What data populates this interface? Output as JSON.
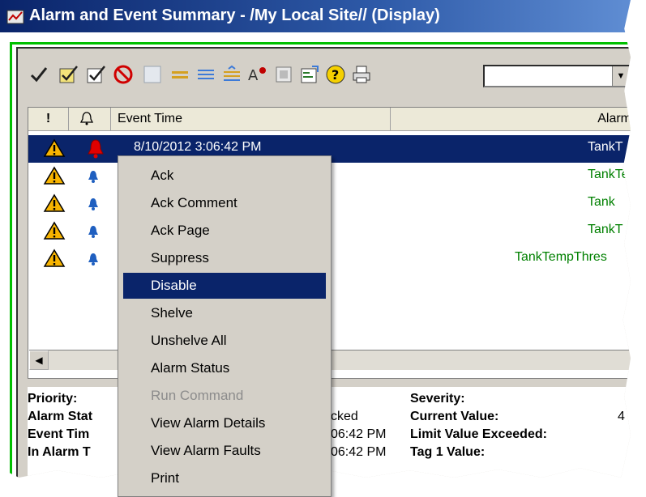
{
  "window": {
    "title": "Alarm and Event Summary - /My Local Site// (Display)",
    "accent_color": "#0a246a",
    "frame_color": "#00c000"
  },
  "toolbar": {
    "buttons": [
      {
        "icon": "check-icon",
        "label": ""
      },
      {
        "icon": "ack-page-icon",
        "label": ""
      },
      {
        "icon": "ack-selected-icon",
        "label": ""
      },
      {
        "icon": "disable-icon",
        "label": ""
      },
      {
        "icon": "blank-icon",
        "label": ""
      },
      {
        "icon": "shelve-icon",
        "label": ""
      },
      {
        "icon": "lines-icon",
        "label": ""
      },
      {
        "icon": "lines-arrow-icon",
        "label": ""
      },
      {
        "icon": "alarm-config-icon",
        "label": ""
      },
      {
        "icon": "filter-icon",
        "label": ""
      },
      {
        "icon": "properties-icon",
        "label": ""
      },
      {
        "icon": "help-icon",
        "label": ""
      },
      {
        "icon": "print-icon",
        "label": ""
      }
    ],
    "combo_value": ""
  },
  "grid": {
    "columns": [
      "!",
      "",
      "Event Time",
      "Alarm"
    ],
    "rows": [
      {
        "priority_icon": "warning-icon",
        "bell_icon": "bell-red-icon",
        "time": "8/10/2012 3:06:42 PM",
        "name": "TankT",
        "selected": true
      },
      {
        "priority_icon": "warning-icon",
        "bell_icon": "bell-blue-icon",
        "time": "",
        "name": "TankTe",
        "selected": false
      },
      {
        "priority_icon": "warning-icon",
        "bell_icon": "bell-blue-icon",
        "time": "",
        "name": "Tank",
        "selected": false
      },
      {
        "priority_icon": "warning-icon",
        "bell_icon": "bell-blue-icon",
        "time": "",
        "name": "TankT",
        "selected": false
      },
      {
        "priority_icon": "warning-icon",
        "bell_icon": "bell-blue-icon",
        "time": "",
        "name": "TankTempThres",
        "selected": false
      }
    ]
  },
  "details": {
    "left_labels": [
      "Priority:",
      "Alarm Stat",
      "Event Tim",
      "In Alarm T"
    ],
    "middle_values": [
      "",
      "cked",
      "06:42 PM",
      "06:42 PM"
    ],
    "right_labels": [
      "Severity:",
      "Current Value:",
      "Limit Value Exceeded:",
      "Tag 1 Value:"
    ],
    "right_values": [
      "",
      "4",
      "",
      ""
    ]
  },
  "context_menu": {
    "items": [
      {
        "label": "Ack",
        "state": "normal"
      },
      {
        "label": "Ack Comment",
        "state": "normal"
      },
      {
        "label": "Ack Page",
        "state": "normal"
      },
      {
        "label": "Suppress",
        "state": "normal"
      },
      {
        "label": "Disable",
        "state": "highlighted"
      },
      {
        "label": "Shelve",
        "state": "normal"
      },
      {
        "label": "Unshelve All",
        "state": "normal"
      },
      {
        "label": "Alarm Status",
        "state": "normal"
      },
      {
        "label": "Run Command",
        "state": "disabled"
      },
      {
        "label": "View Alarm Details",
        "state": "normal"
      },
      {
        "label": "View Alarm Faults",
        "state": "normal"
      },
      {
        "label": "Print",
        "state": "normal"
      }
    ]
  }
}
